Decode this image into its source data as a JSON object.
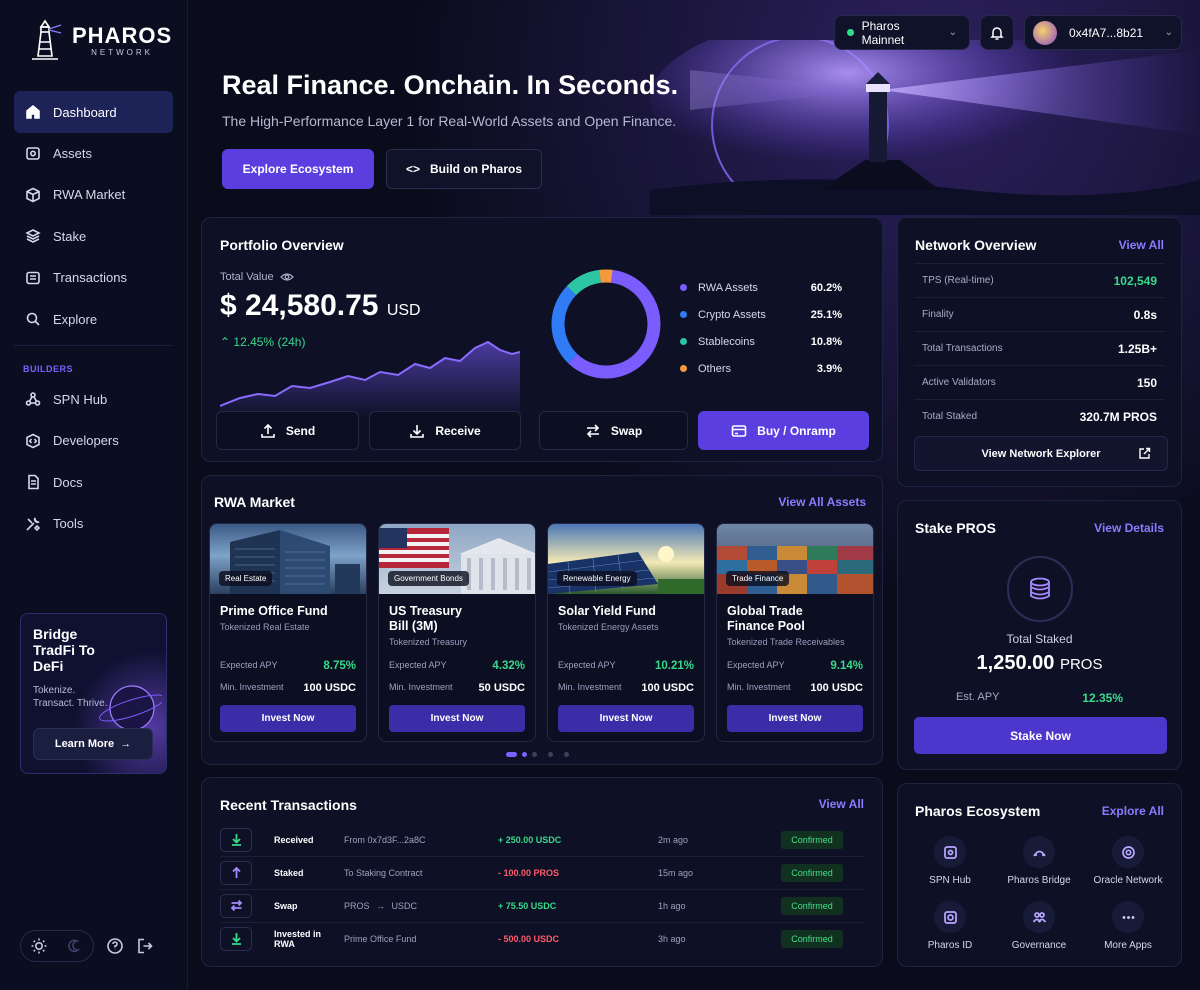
{
  "brand": {
    "title": "PHAROS",
    "subtitle": "NETWORK"
  },
  "sidebar": {
    "items": [
      {
        "label": "Dashboard",
        "icon": "home-icon"
      },
      {
        "label": "Assets",
        "icon": "wallet-icon"
      },
      {
        "label": "RWA Market",
        "icon": "cube-icon"
      },
      {
        "label": "Stake",
        "icon": "layers-icon"
      },
      {
        "label": "Transactions",
        "icon": "receipt-icon"
      },
      {
        "label": "Explore",
        "icon": "search-icon"
      }
    ],
    "section_label": "BUILDERS",
    "builder_items": [
      {
        "label": "SPN Hub",
        "icon": "share-icon"
      },
      {
        "label": "Developers",
        "icon": "code-icon"
      },
      {
        "label": "Docs",
        "icon": "doc-icon"
      },
      {
        "label": "Tools",
        "icon": "tools-icon"
      }
    ],
    "promo": {
      "title": "Bridge TradFi To DeFi",
      "subtitle": "Tokenize. Transact. Thrive.",
      "button": "Learn More"
    }
  },
  "topbar": {
    "network": "Pharos Mainnet",
    "wallet": "0x4fA7...8b21"
  },
  "hero": {
    "title": "Real Finance. Onchain. In Seconds.",
    "subtitle": "The High-Performance Layer 1 for Real-World Assets and Open Finance.",
    "primary_button": "Explore Ecosystem",
    "secondary_button": "Build on Pharos"
  },
  "portfolio": {
    "title": "Portfolio Overview",
    "total_label": "Total Value",
    "value": "$ 24,580.75",
    "currency": "USD",
    "change": "12.45%",
    "change_period": "(24h)",
    "actions": [
      "Send",
      "Receive",
      "Swap",
      "Buy / Onramp"
    ],
    "allocation": [
      {
        "name": "RWA Assets",
        "pct": "60.2%",
        "value": 60.2,
        "color": "#7b5cff"
      },
      {
        "name": "Crypto Assets",
        "pct": "25.1%",
        "value": 25.1,
        "color": "#2f7cf6"
      },
      {
        "name": "Stablecoins",
        "pct": "10.8%",
        "value": 10.8,
        "color": "#2cc6a3"
      },
      {
        "name": "Others",
        "pct": "3.9%",
        "value": 3.9,
        "color": "#f59a3c"
      }
    ]
  },
  "network": {
    "title": "Network Overview",
    "link": "View All",
    "rows": [
      {
        "label": "TPS (Real-time)",
        "value": "102,549"
      },
      {
        "label": "Finality",
        "value": "0.8s"
      },
      {
        "label": "Total Transactions",
        "value": "1.25B+"
      },
      {
        "label": "Active Validators",
        "value": "150"
      },
      {
        "label": "Total Staked",
        "value": "320.7M PROS"
      }
    ],
    "button": "View Network Explorer"
  },
  "rwa": {
    "title": "RWA Market",
    "link": "View All Assets",
    "apy_label": "Expected APY",
    "min_label": "Min. Investment",
    "invest_label": "Invest Now",
    "assets": [
      {
        "tag": "Real Estate",
        "name": "Prime Office Fund",
        "sub": "Tokenized Real Estate",
        "apy": "8.75%",
        "min": "100 USDC"
      },
      {
        "tag": "Government Bonds",
        "name": "US Treasury Bill (3M)",
        "sub": "Tokenized Treasury",
        "apy": "4.32%",
        "min": "50 USDC"
      },
      {
        "tag": "Renewable Energy",
        "name": "Solar Yield Fund",
        "sub": "Tokenized Energy Assets",
        "apy": "10.21%",
        "min": "100 USDC"
      },
      {
        "tag": "Trade Finance",
        "name": "Global Trade Finance Pool",
        "sub": "Tokenized Trade Receivables",
        "apy": "9.14%",
        "min": "100 USDC"
      }
    ]
  },
  "stake": {
    "title": "Stake PROS",
    "link": "View Details",
    "label": "Total Staked",
    "value": "1,250.00",
    "unit": "PROS",
    "apy_label": "Est. APY",
    "apy": "12.35%",
    "button": "Stake Now"
  },
  "transactions": {
    "title": "Recent Transactions",
    "link": "View All",
    "rows": [
      {
        "type": "Received",
        "detail": "From 0x7d3F...2a8C",
        "amount": "+ 250.00 USDC",
        "time": "2m ago",
        "status": "Confirmed",
        "icon": "arrow-down-icon"
      },
      {
        "type": "Staked",
        "detail": "To Staking Contract",
        "amount": "- 100.00 PROS",
        "time": "15m ago",
        "status": "Confirmed",
        "icon": "arrow-up-icon"
      },
      {
        "type": "Swap",
        "detail_from": "PROS",
        "detail_to": "USDC",
        "amount": "+ 75.50 USDC",
        "time": "1h ago",
        "status": "Confirmed",
        "icon": "swap-icon"
      },
      {
        "type": "Invested in RWA",
        "detail": "Prime Office Fund",
        "amount": "- 500.00 USDC",
        "time": "3h ago",
        "status": "Confirmed",
        "icon": "arrow-down-icon"
      }
    ]
  },
  "ecosystem": {
    "title": "Pharos Ecosystem",
    "link": "Explore All",
    "apps": [
      "SPN Hub",
      "Pharos Bridge",
      "Oracle Network",
      "Pharos ID",
      "Governance",
      "More Apps"
    ]
  }
}
